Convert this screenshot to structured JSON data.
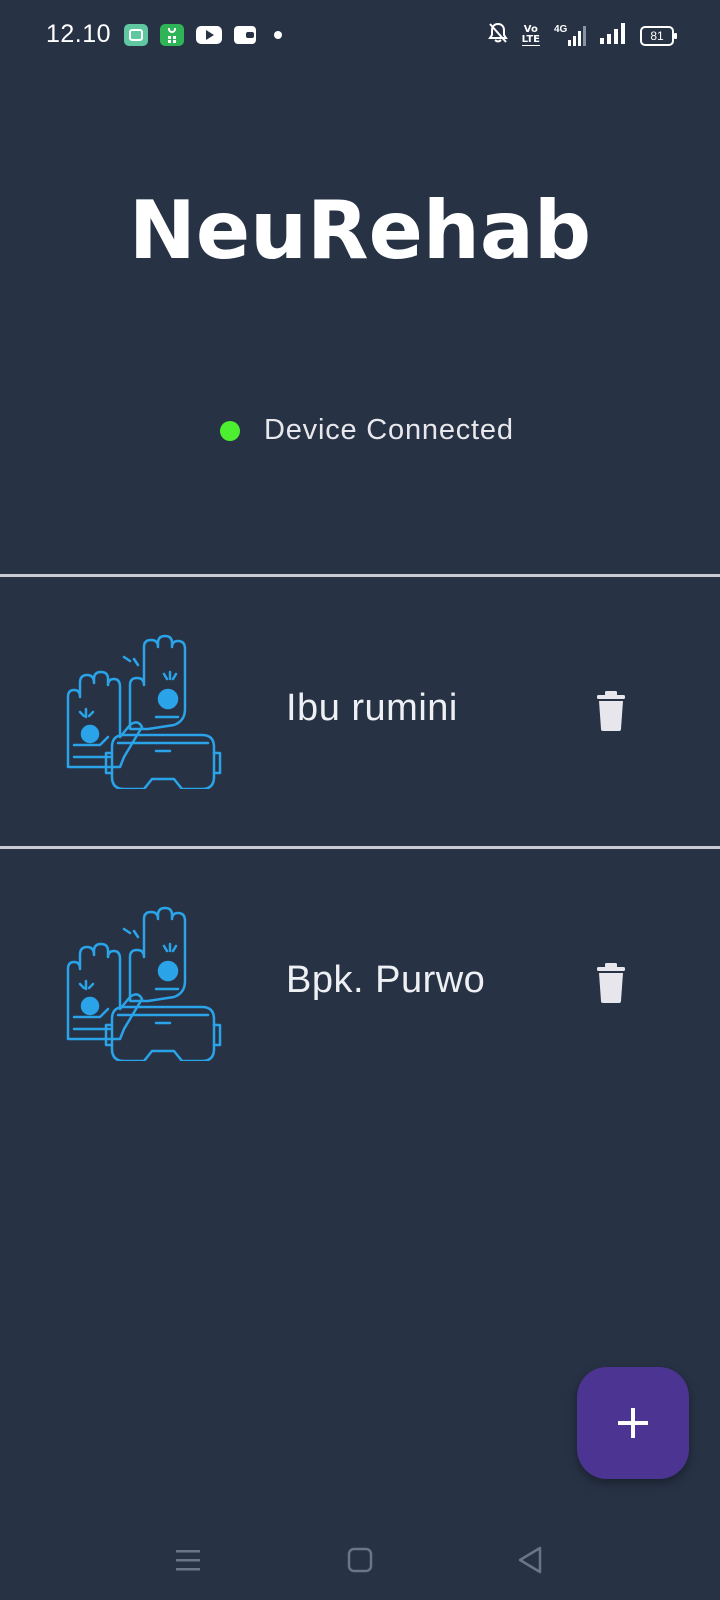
{
  "status_bar": {
    "time": "12.10",
    "notification_icons": [
      "gallery-app-icon",
      "shopping-app-icon",
      "youtube-icon",
      "wallet-icon"
    ],
    "system_icons": [
      "mute-bell-icon",
      "volte-icon",
      "signal-4g-icon",
      "signal-icon",
      "battery-icon"
    ],
    "volte_top": "Vo",
    "volte_bottom": "LTE",
    "network_label": "4G",
    "battery_level": "81"
  },
  "app": {
    "title": "NeuRehab"
  },
  "connection": {
    "status_text": "Device Connected",
    "status_color": "#4cf031"
  },
  "patients": [
    {
      "name": "Ibu rumini",
      "icon": "rehab-gloves-vr-icon",
      "action_icon": "trash-icon"
    },
    {
      "name": "Bpk. Purwo",
      "icon": "rehab-gloves-vr-icon",
      "action_icon": "trash-icon"
    }
  ],
  "fab": {
    "icon": "plus-icon",
    "color": "#4c3592"
  },
  "nav_bar": {
    "buttons": [
      "menu-icon",
      "home-icon",
      "back-icon"
    ]
  },
  "colors": {
    "background": "#273245",
    "accent": "#2aa3e8",
    "divider": "#c8ccd2"
  }
}
